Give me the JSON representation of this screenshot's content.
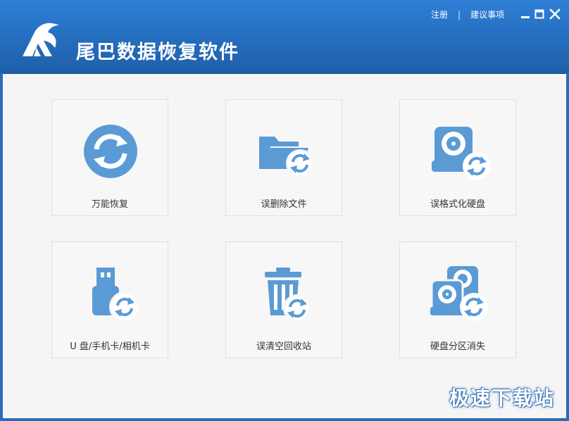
{
  "app": {
    "title": "尾巴数据恢复软件"
  },
  "header_links": {
    "register": "注册",
    "separator": "|",
    "suggestions": "建议事项"
  },
  "window_controls": {
    "minimize_icon": "minimize-icon",
    "maximize_icon": "maximize-icon",
    "close_icon": "close-icon"
  },
  "cards": [
    {
      "label": "万能恢复",
      "icon": "universal-recovery-icon"
    },
    {
      "label": "误删除文件",
      "icon": "deleted-files-icon"
    },
    {
      "label": "误格式化硬盘",
      "icon": "formatted-disk-icon"
    },
    {
      "label": "U 盘/手机卡/相机卡",
      "icon": "usb-card-icon"
    },
    {
      "label": "误清空回收站",
      "icon": "recycle-bin-icon"
    },
    {
      "label": "硬盘分区消失",
      "icon": "lost-partition-icon"
    }
  ],
  "watermark": "极速下载站",
  "colors": {
    "titlebar": "#2670c2",
    "icon_blue": "#5b9bd5",
    "background": "#f5f5f5",
    "text": "#333333"
  }
}
